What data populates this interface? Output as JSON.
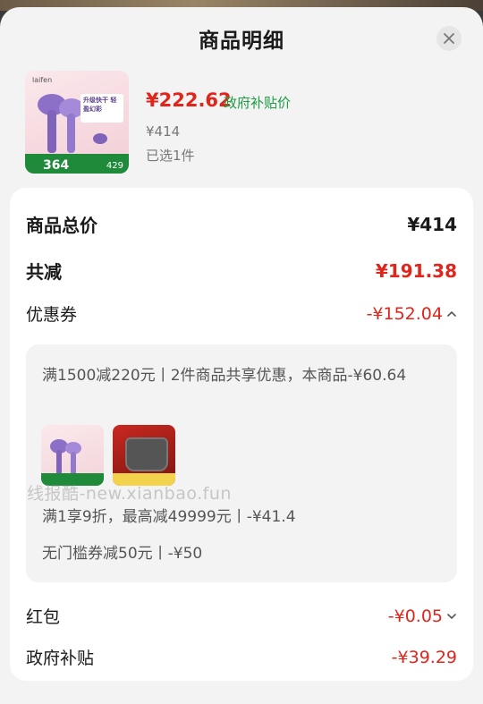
{
  "header": {
    "title": "商品明细"
  },
  "product": {
    "price": "¥222.62",
    "price_label": "政府补贴价",
    "original_price": "¥414",
    "selected": "已选1件",
    "image": {
      "brand": "laifen",
      "tag": "升级快干 轻盈幻彩",
      "promo_num": "364",
      "promo_num2": "429"
    }
  },
  "summary": {
    "total_label": "商品总价",
    "total_value": "¥414",
    "discount_label": "共减",
    "discount_value": "¥191.38",
    "coupon_label": "优惠券",
    "coupon_value": "-¥152.04",
    "hongbao_label": "红包",
    "hongbao_value": "-¥0.05",
    "subsidy_label": "政府补贴",
    "subsidy_value": "-¥39.29"
  },
  "coupons": {
    "shared_desc": "满1500减220元丨2件商品共享优惠，本商品-¥60.64",
    "line2": "满1享9折，最高减49999元丨-¥41.4",
    "line3": "无门槛券减50元丨-¥50"
  },
  "watermark": "线报酷-new.xianbao.fun",
  "colors": {
    "accent_red": "#e1251b",
    "gov_green": "#1d9a43"
  }
}
